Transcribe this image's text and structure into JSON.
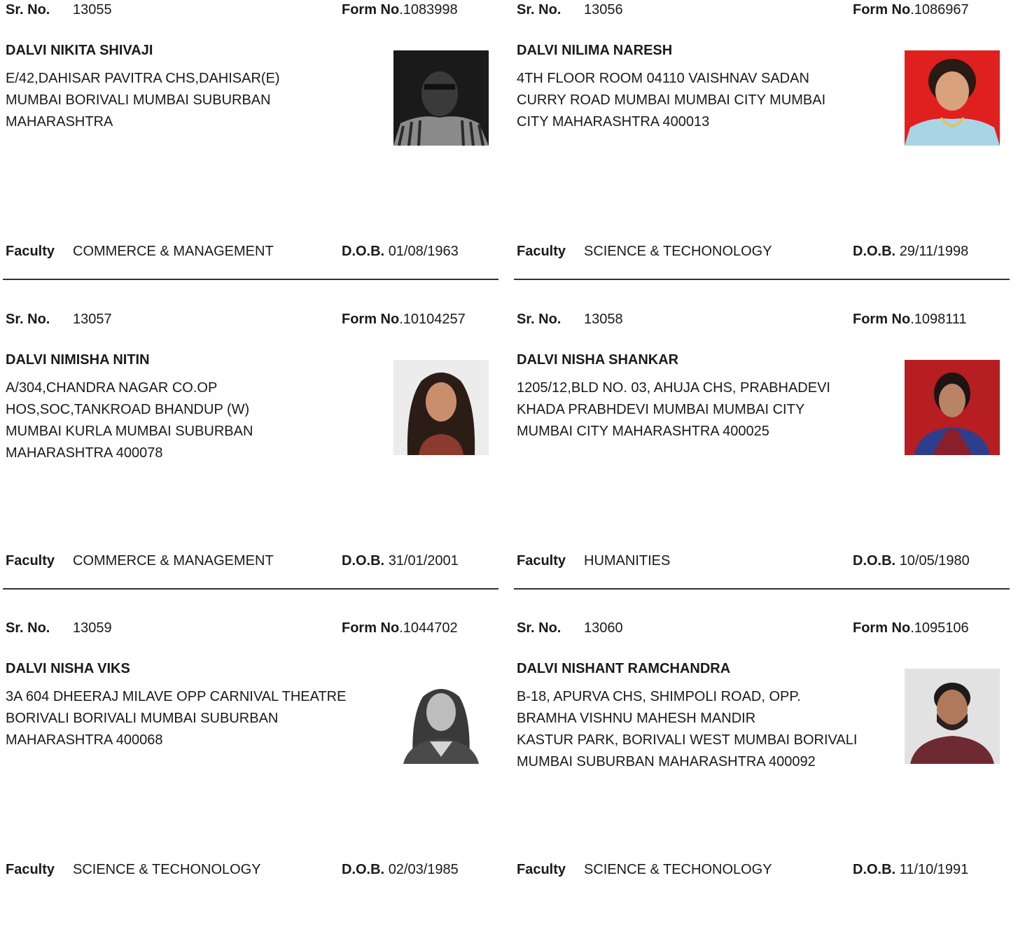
{
  "labels": {
    "sr_no": "Sr. No.",
    "form_no": "Form No",
    "faculty": "Faculty",
    "dob": "D.O.B."
  },
  "records": [
    {
      "sr_no": "13055",
      "form_no": ".1083998",
      "name": "DALVI NIKITA SHIVAJI",
      "address": "E/42,DAHISAR PAVITRA CHS,DAHISAR(E)\n MUMBAI BORIVALI MUMBAI SUBURBAN\nMAHARASHTRA",
      "faculty": "COMMERCE & MANAGEMENT",
      "dob": "01/08/1963"
    },
    {
      "sr_no": "13056",
      "form_no": ".1086967",
      "name": "DALVI NILIMA NARESH",
      "address": "4TH FLOOR ROOM 04110 VAISHNAV SADAN\nCURRY ROAD MUMBAI MUMBAI CITY MUMBAI\nCITY MAHARASHTRA 400013",
      "faculty": "SCIENCE & TECHONOLOGY",
      "dob": "29/11/1998"
    },
    {
      "sr_no": "13057",
      "form_no": ".10104257",
      "name": "DALVI NIMISHA NITIN",
      "address": "A/304,CHANDRA NAGAR CO.OP\nHOS,SOC,TANKROAD BHANDUP (W)\n MUMBAI KURLA MUMBAI SUBURBAN\nMAHARASHTRA 400078",
      "faculty": "COMMERCE & MANAGEMENT",
      "dob": "31/01/2001"
    },
    {
      "sr_no": "13058",
      "form_no": ".1098111",
      "name": "DALVI NISHA SHANKAR",
      "address": "1205/12,BLD NO. 03, AHUJA CHS, PRABHADEVI\nKHADA PRABHDEVI MUMBAI MUMBAI CITY\nMUMBAI CITY MAHARASHTRA 400025",
      "faculty": "HUMANITIES",
      "dob": "10/05/1980"
    },
    {
      "sr_no": "13059",
      "form_no": ".1044702",
      "name": "DALVI NISHA VIKS",
      "address": "3A 604 DHEERAJ MILAVE OPP CARNIVAL THEATRE\n BORIVALI BORIVALI MUMBAI SUBURBAN\nMAHARASHTRA 400068",
      "faculty": "SCIENCE & TECHONOLOGY",
      "dob": "02/03/1985"
    },
    {
      "sr_no": "13060",
      "form_no": ".1095106",
      "name": "DALVI NISHANT RAMCHANDRA",
      "address": "B-18, APURVA CHS, SHIMPOLI ROAD, OPP.\nBRAMHA VISHNU MAHESH MANDIR\nKASTUR PARK, BORIVALI WEST MUMBAI BORIVALI\nMUMBAI SUBURBAN MAHARASHTRA 400092",
      "faculty": "SCIENCE & TECHONOLOGY",
      "dob": "11/10/1991"
    }
  ]
}
